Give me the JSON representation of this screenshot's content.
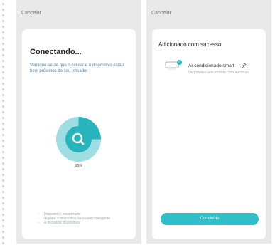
{
  "left_screen": {
    "cancel_label": "Cancelar",
    "title": "Conectando...",
    "subtitle": "Verifique-se de que o celular e o dispositivo estão bem próximos do seu roteador",
    "progress_percent": 25,
    "progress_label": "25%",
    "steps": [
      "Dispositivo encontrado",
      "registre o dispositivo na nuvem inteligente",
      "A inicializar dispositivo"
    ],
    "accent_color": "#27b4bd"
  },
  "right_screen": {
    "cancel_label": "Cancelar",
    "title": "Adicionado com sucesso",
    "device_name": "Ar condicionado smart",
    "device_status": "Dispositivo adicionado com sucesso.",
    "done_button": "Concluído"
  },
  "icons": [
    "search-icon",
    "air-conditioner-icon",
    "check-icon",
    "edit-pencil-icon"
  ]
}
